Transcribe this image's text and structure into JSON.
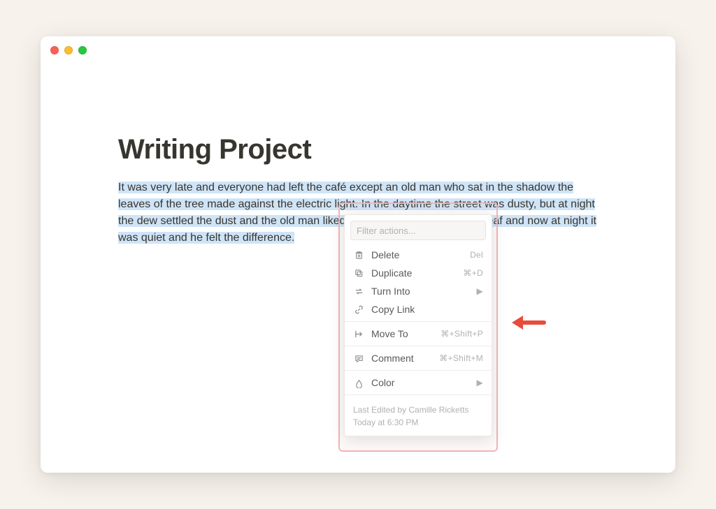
{
  "page": {
    "title": "Writing Project",
    "paragraph": "It was very late and everyone had left the café except an old man who sat in the shadow the leaves of the tree made against the electric light. In the daytime the street was dusty, but at night the dew settled the dust and the old man liked to sit late because he was deaf and now at night it was quiet and he felt the difference."
  },
  "menu": {
    "filter_placeholder": "Filter actions...",
    "items": {
      "delete": {
        "label": "Delete",
        "shortcut": "Del"
      },
      "duplicate": {
        "label": "Duplicate",
        "shortcut": "⌘+D"
      },
      "turn_into": {
        "label": "Turn Into"
      },
      "copy_link": {
        "label": "Copy Link"
      },
      "move_to": {
        "label": "Move To",
        "shortcut": "⌘+Shift+P"
      },
      "comment": {
        "label": "Comment",
        "shortcut": "⌘+Shift+M"
      },
      "color": {
        "label": "Color"
      }
    },
    "footer": {
      "edited_by": "Last Edited by Camille Ricketts",
      "timestamp": "Today at 6:30 PM"
    }
  }
}
